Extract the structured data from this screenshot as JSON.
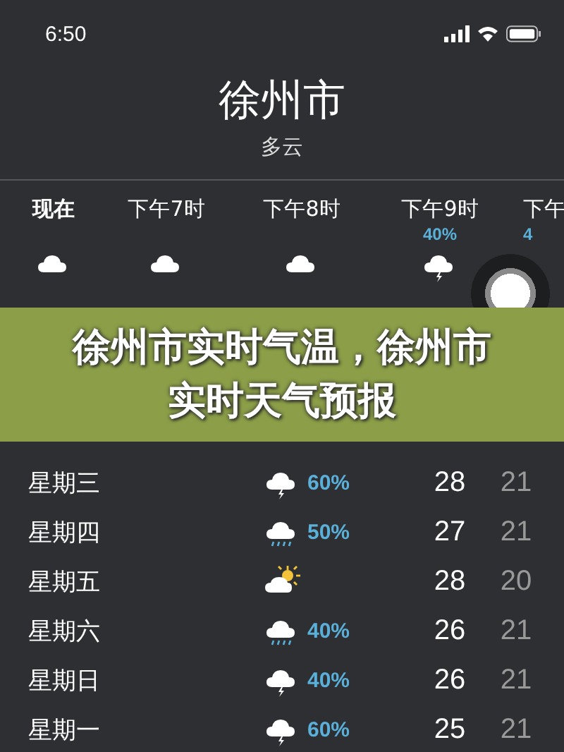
{
  "status_bar": {
    "time": "6:50"
  },
  "location": {
    "city": "徐州市",
    "condition": "多云"
  },
  "hourly": [
    {
      "time": "现在",
      "current": true,
      "kind": "cloud"
    },
    {
      "time": "下午7时",
      "current": false,
      "kind": "cloud"
    },
    {
      "time": "下午8时",
      "current": false,
      "kind": "cloud"
    },
    {
      "time": "下午9时",
      "current": false,
      "chance": "40%",
      "kind": "thunder"
    },
    {
      "time": "下午",
      "current": false,
      "chance": "4"
    }
  ],
  "daily": [
    {
      "day": "星期三",
      "kind": "thunder",
      "chance": "60%",
      "high": "28",
      "low": "21"
    },
    {
      "day": "星期四",
      "kind": "rain",
      "chance": "50%",
      "high": "27",
      "low": "21"
    },
    {
      "day": "星期五",
      "kind": "partly_sunny",
      "high": "28",
      "low": "20"
    },
    {
      "day": "星期六",
      "kind": "rain",
      "chance": "40%",
      "high": "26",
      "low": "21"
    },
    {
      "day": "星期日",
      "kind": "thunder",
      "chance": "40%",
      "high": "26",
      "low": "21"
    },
    {
      "day": "星期一",
      "kind": "thunder",
      "chance": "60%",
      "high": "25",
      "low": "21"
    }
  ],
  "banner": {
    "title": "徐州市实时气温，徐州市实时天气预报"
  }
}
